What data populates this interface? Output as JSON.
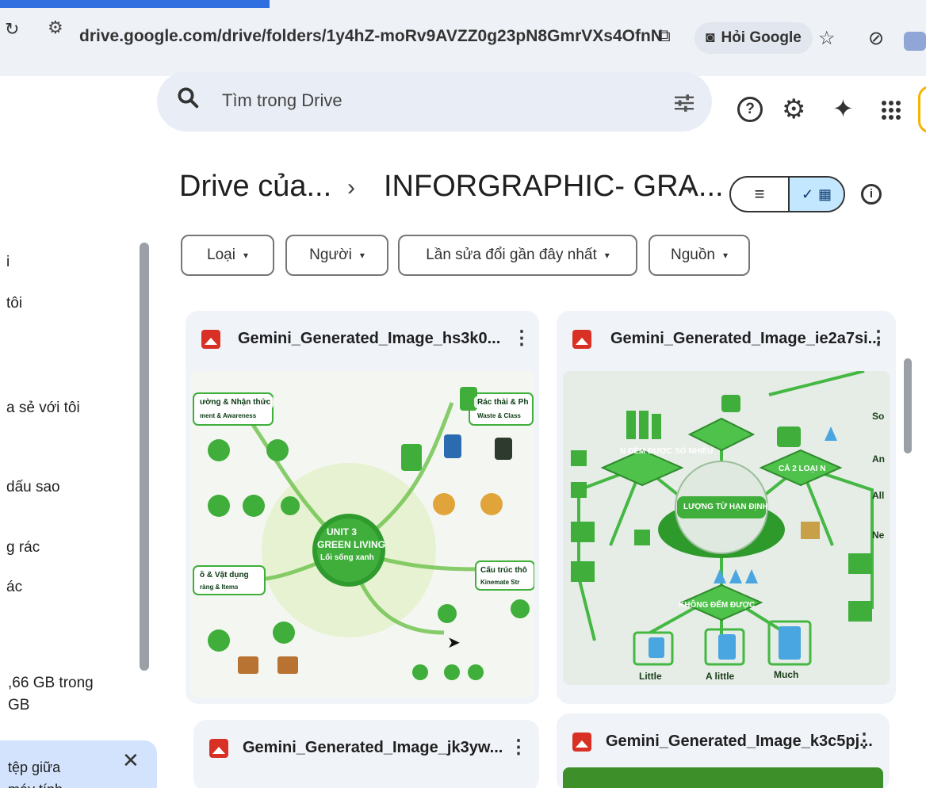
{
  "browser": {
    "url": "drive.google.com/drive/folders/1y4hZ-moRv9AVZZ0g23pN8GmrVXs4OfnN",
    "ask_google_label": "Hỏi Google",
    "icons": [
      "site-info-icon",
      "cast-icon",
      "google-lens-icon",
      "star-icon",
      "extension-icon"
    ]
  },
  "header": {
    "search_placeholder": "Tìm trong Drive",
    "icons": [
      "search-icon",
      "tune-icon",
      "help-icon",
      "settings-icon",
      "gemini-icon",
      "apps-icon"
    ]
  },
  "breadcrumb": {
    "root": "Drive của...",
    "separator": "›",
    "current": "INFORGRAPHIC- GRA...",
    "current_caret": "▾"
  },
  "view_toggle": {
    "list_icon": "≡",
    "grid_check": "✓",
    "grid_icon": "▦",
    "selected": "grid"
  },
  "filters": [
    {
      "label": "Loại",
      "caret": "▾"
    },
    {
      "label": "Người",
      "caret": "▾"
    },
    {
      "label": "Lần sửa đổi gần đây nhất",
      "caret": "▾"
    },
    {
      "label": "Nguồn",
      "caret": "▾"
    }
  ],
  "sidebar": {
    "items": [
      {
        "label": "i"
      },
      {
        "label": "tôi"
      },
      {
        "label": "a sẻ với tôi"
      },
      {
        "label": "dấu sao"
      },
      {
        "label": "g rác"
      },
      {
        "label": "ác"
      }
    ],
    "storage_line1": ",66 GB trong",
    "storage_line2": "GB",
    "banner_line1": "tệp giữa",
    "banner_line2": "máy tính",
    "banner_close": "✕"
  },
  "files": [
    {
      "name": "Gemini_Generated_Image_hs3k0...",
      "thumbnail": {
        "center_line1": "UNIT 3",
        "center_line2": "GREEN LIVING",
        "center_line3": "Lối sống xanh",
        "labels": [
          "ường & Nhận thức",
          "Rác thải & Ph",
          "ồ & Vật dụng",
          "Cấu trúc thô"
        ],
        "sublabels": [
          "ment & Awareness",
          "Waste & Class",
          "ràng & Items",
          "Kinemate Str"
        ]
      }
    },
    {
      "name": "Gemini_Generated_Image_ie2a7si...",
      "thumbnail": {
        "labels": [
          "N ĐẾM ĐƯỢC SỐ NHIỀU",
          "CẢ 2 LOẠI N",
          "KHÔNG ĐẾM ĐƯỢC",
          "LƯỢNG TỪ HẠN ĐỊNH"
        ],
        "bottom_labels": [
          "Little",
          "A little",
          "Much"
        ],
        "edge_labels": [
          "So",
          "An",
          "All",
          "Ne"
        ]
      }
    },
    {
      "name": "Gemini_Generated_Image_jk3yw..."
    },
    {
      "name": "Gemini_Generated_Image_k3c5pj..."
    }
  ],
  "more_icon": "⋮",
  "colors": {
    "accent": "#c2e7ff",
    "thumb_green": "#3fae3a",
    "card_bg": "#f0f4f9",
    "image_icon": "#d93025"
  }
}
